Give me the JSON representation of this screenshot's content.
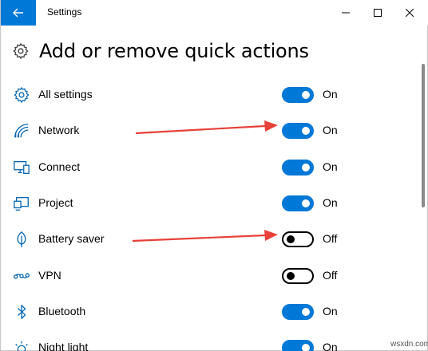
{
  "window": {
    "title": "Settings",
    "controls": {
      "minimize": "minimize",
      "maximize": "maximize",
      "close": "close"
    }
  },
  "header": {
    "title": "Add or remove quick actions",
    "icon": "gear-icon"
  },
  "rows": [
    {
      "label": "All settings",
      "icon": "gear-icon",
      "state": "On",
      "on": true
    },
    {
      "label": "Network",
      "icon": "wifi-icon",
      "state": "On",
      "on": true
    },
    {
      "label": "Connect",
      "icon": "connect-icon",
      "state": "On",
      "on": true
    },
    {
      "label": "Project",
      "icon": "project-icon",
      "state": "On",
      "on": true
    },
    {
      "label": "Battery saver",
      "icon": "leaf-icon",
      "state": "Off",
      "on": false
    },
    {
      "label": "VPN",
      "icon": "vpn-icon",
      "state": "Off",
      "on": false
    },
    {
      "label": "Bluetooth",
      "icon": "bluetooth-icon",
      "state": "On",
      "on": true
    },
    {
      "label": "Night light",
      "icon": "night-light-icon",
      "state": "On",
      "on": true
    }
  ],
  "annotations": {
    "arrow_color": "#e8413a"
  },
  "colors": {
    "accent": "#0078d7"
  },
  "watermark": "wsxdn.com"
}
